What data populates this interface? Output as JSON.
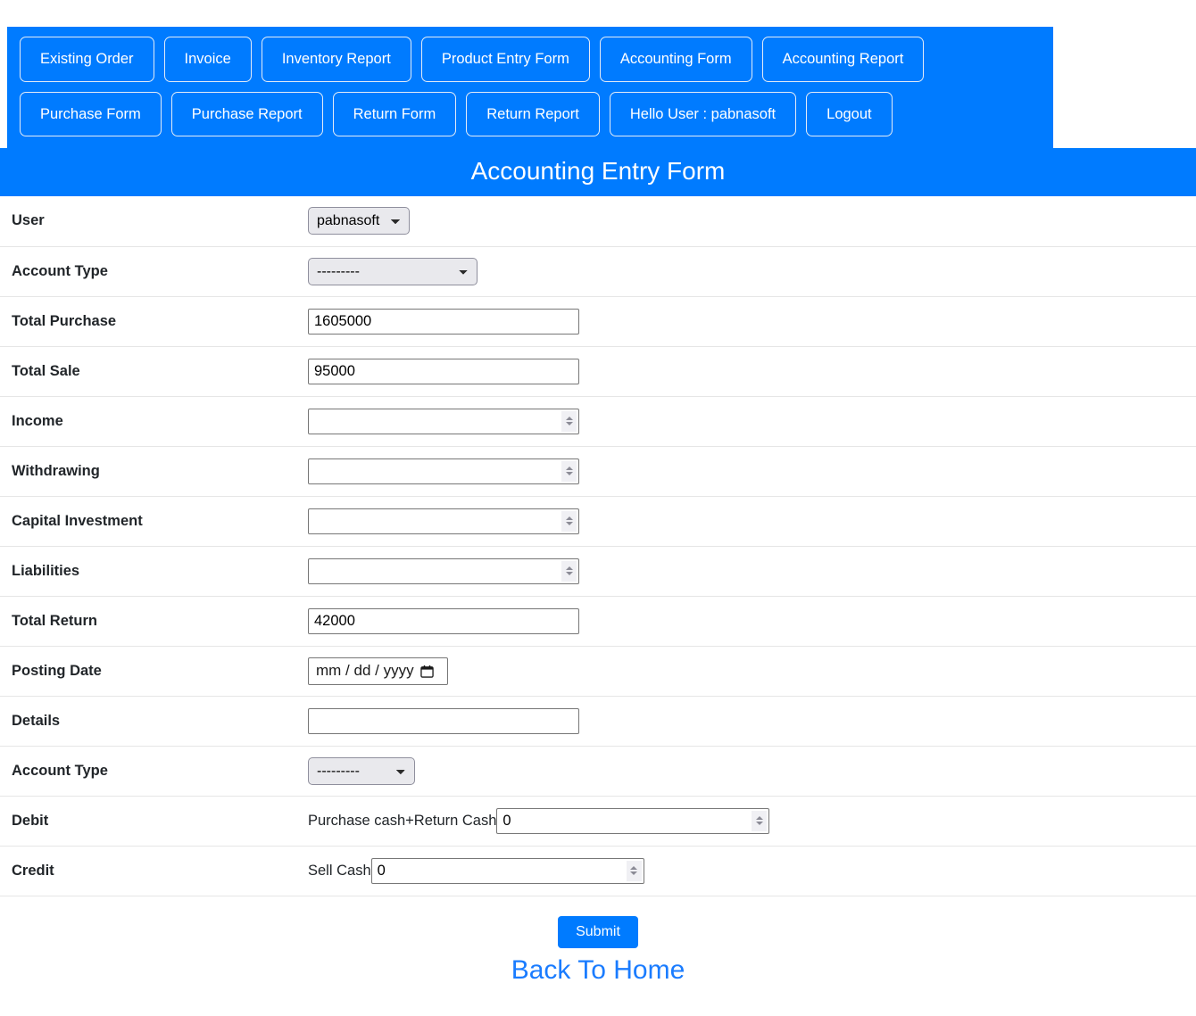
{
  "nav": {
    "rows": [
      [
        {
          "label": "Existing Order",
          "name": "nav-existing-order"
        },
        {
          "label": "Invoice",
          "name": "nav-invoice"
        },
        {
          "label": "Inventory Report",
          "name": "nav-inventory-report"
        },
        {
          "label": "Product Entry Form",
          "name": "nav-product-entry-form"
        },
        {
          "label": "Accounting Form",
          "name": "nav-accounting-form"
        },
        {
          "label": "Accounting Report",
          "name": "nav-accounting-report"
        }
      ],
      [
        {
          "label": "Purchase Form",
          "name": "nav-purchase-form"
        },
        {
          "label": "Purchase Report",
          "name": "nav-purchase-report"
        },
        {
          "label": "Return Form",
          "name": "nav-return-form"
        },
        {
          "label": "Return Report",
          "name": "nav-return-report"
        },
        {
          "label": "Hello User : pabnasoft",
          "name": "nav-hello-user"
        },
        {
          "label": "Logout",
          "name": "nav-logout"
        }
      ]
    ]
  },
  "header": {
    "title": "Accounting Entry Form"
  },
  "form": {
    "user": {
      "label": "User",
      "value": "pabnasoft"
    },
    "account_type_1": {
      "label": "Account Type",
      "value": "---------"
    },
    "total_purchase": {
      "label": "Total Purchase",
      "value": "1605000"
    },
    "total_sale": {
      "label": "Total Sale",
      "value": "95000"
    },
    "income": {
      "label": "Income",
      "value": ""
    },
    "withdrawing": {
      "label": "Withdrawing",
      "value": ""
    },
    "capital_investment": {
      "label": "Capital Investment",
      "value": ""
    },
    "liabilities": {
      "label": "Liabilities",
      "value": ""
    },
    "total_return": {
      "label": "Total Return",
      "value": "42000"
    },
    "posting_date": {
      "label": "Posting Date",
      "placeholder": "mm / dd / yyyy"
    },
    "details": {
      "label": "Details",
      "value": ""
    },
    "account_type_2": {
      "label": "Account Type",
      "value": "---------"
    },
    "debit": {
      "label": "Debit",
      "prefix": "Purchase cash+Return Cash",
      "value": "0"
    },
    "credit": {
      "label": "Credit",
      "prefix": "Sell Cash",
      "value": "0"
    }
  },
  "footer": {
    "submit_label": "Submit",
    "back_home_label": "Back To Home"
  },
  "colors": {
    "brand_blue": "#007bff",
    "link_blue": "#1a7cff",
    "select_bg": "#e9e9ed",
    "row_border": "#e6e6e6"
  }
}
